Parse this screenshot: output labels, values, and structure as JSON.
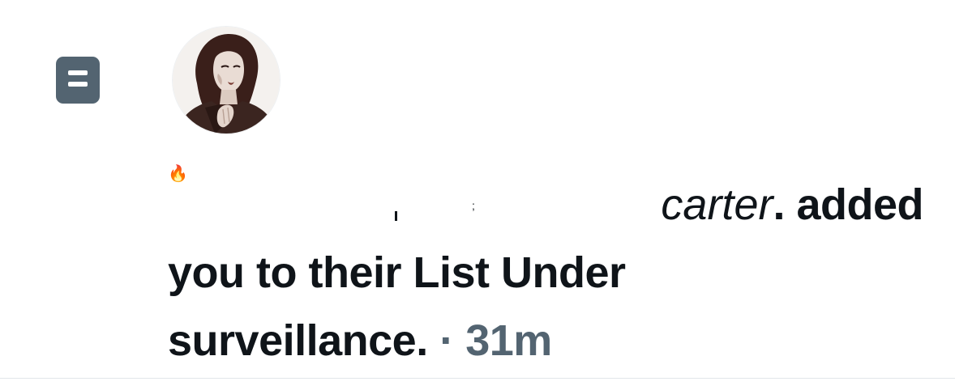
{
  "notification": {
    "icon": "list-icon",
    "avatar": "user-avatar",
    "name_glyphs": {
      "flame": "🔥",
      "tick": "",
      "semicolon": ";"
    },
    "actor_name": "carter",
    "action_text_line1": ". added",
    "action_text_line2": "you to their List Under",
    "list_name_end": "surveillance.",
    "separator": "·",
    "timestamp": "31m"
  },
  "colors": {
    "text_primary": "#0f1419",
    "text_secondary": "#536471",
    "list_icon_bg": "#536471",
    "divider": "#e1e6ea"
  }
}
